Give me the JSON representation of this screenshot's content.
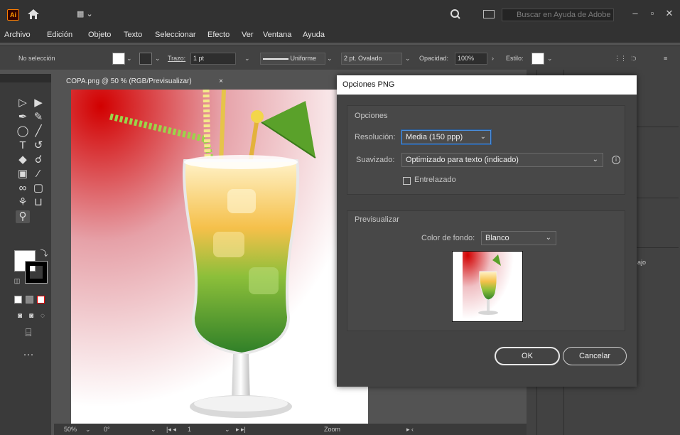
{
  "app": {
    "logo_text": "Ai"
  },
  "search": {
    "placeholder": "Buscar en Ayuda de Adobe"
  },
  "menu": [
    "Archivo",
    "Edición",
    "Objeto",
    "Texto",
    "Seleccionar",
    "Efecto",
    "Ver",
    "Ventana",
    "Ayuda"
  ],
  "control_bar": {
    "selection_status": "No selección",
    "stroke_label": "Trazo:",
    "stroke_weight": "1 pt",
    "stroke_profile": "Uniforme",
    "brush": "2 pt. Ovalado",
    "opacity_label": "Opacidad:",
    "opacity_value": "100%",
    "style_label": "Estilo:"
  },
  "document": {
    "tab_title": "COPA.png @ 50 % (RGB/Previsualizar)",
    "tab_close": "×"
  },
  "statusbar": {
    "zoom": "50%",
    "rotation": "0°",
    "artboard_number": "1",
    "mode": "Zoom"
  },
  "right_panel": {
    "partial_text": "ajo"
  },
  "dialog": {
    "title": "Opciones PNG",
    "options_group": "Opciones",
    "resolution_label": "Resolución:",
    "resolution_value": "Media (150 ppp)",
    "antialias_label": "Suavizado:",
    "antialias_value": "Optimizado para texto (indicado)",
    "interlaced_label": "Entrelazado",
    "interlaced_checked": false,
    "preview_group": "Previsualizar",
    "bg_color_label": "Color de fondo:",
    "bg_color_value": "Blanco",
    "ok_label": "OK",
    "cancel_label": "Cancelar"
  },
  "colors": {
    "chrome_dark": "#323232",
    "panel": "#424242",
    "dialog_bg": "#434343",
    "focus_blue": "#4a8fe0",
    "artwork_red": "#d10000"
  }
}
